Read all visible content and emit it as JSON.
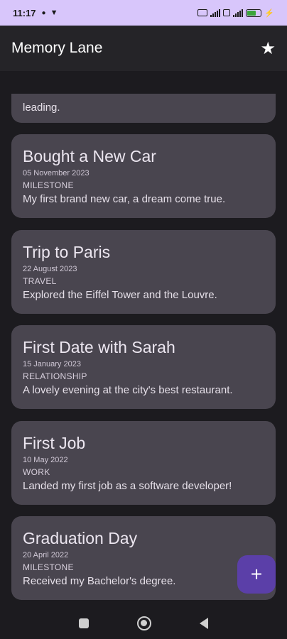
{
  "status_bar": {
    "time": "11:17",
    "left_icons": [
      "notification-dot-icon",
      "shield-icon"
    ],
    "right_icons": [
      "sim-icon",
      "signal-icon",
      "volte-icon",
      "signal-icon-2",
      "battery-icon",
      "charging-icon"
    ]
  },
  "app_bar": {
    "title": "Memory Lane",
    "action_icon": "star-icon"
  },
  "memories": [
    {
      "title": "",
      "date": "",
      "category": "",
      "description": "leading."
    },
    {
      "title": "Bought a New Car",
      "date": "05 November 2023",
      "category": "MILESTONE",
      "description": "My first brand new car, a dream come true."
    },
    {
      "title": "Trip to Paris",
      "date": "22 August 2023",
      "category": "TRAVEL",
      "description": "Explored the Eiffel Tower and the Louvre."
    },
    {
      "title": "First Date with Sarah",
      "date": "15 January 2023",
      "category": "RELATIONSHIP",
      "description": "A lovely evening at the city's best restaurant."
    },
    {
      "title": "First Job",
      "date": "10 May 2022",
      "category": "WORK",
      "description": "Landed my first job as a software developer!"
    },
    {
      "title": "Graduation Day",
      "date": "20 April 2022",
      "category": "MILESTONE",
      "description": "Received my Bachelor's degree."
    }
  ],
  "fab": {
    "label": "+",
    "icon": "add-icon"
  },
  "colors": {
    "status_bar": "#d8c6fb",
    "app_bar": "#252428",
    "card": "#49454f",
    "fab": "#5b3fa8",
    "background": "#1c1b1f"
  }
}
